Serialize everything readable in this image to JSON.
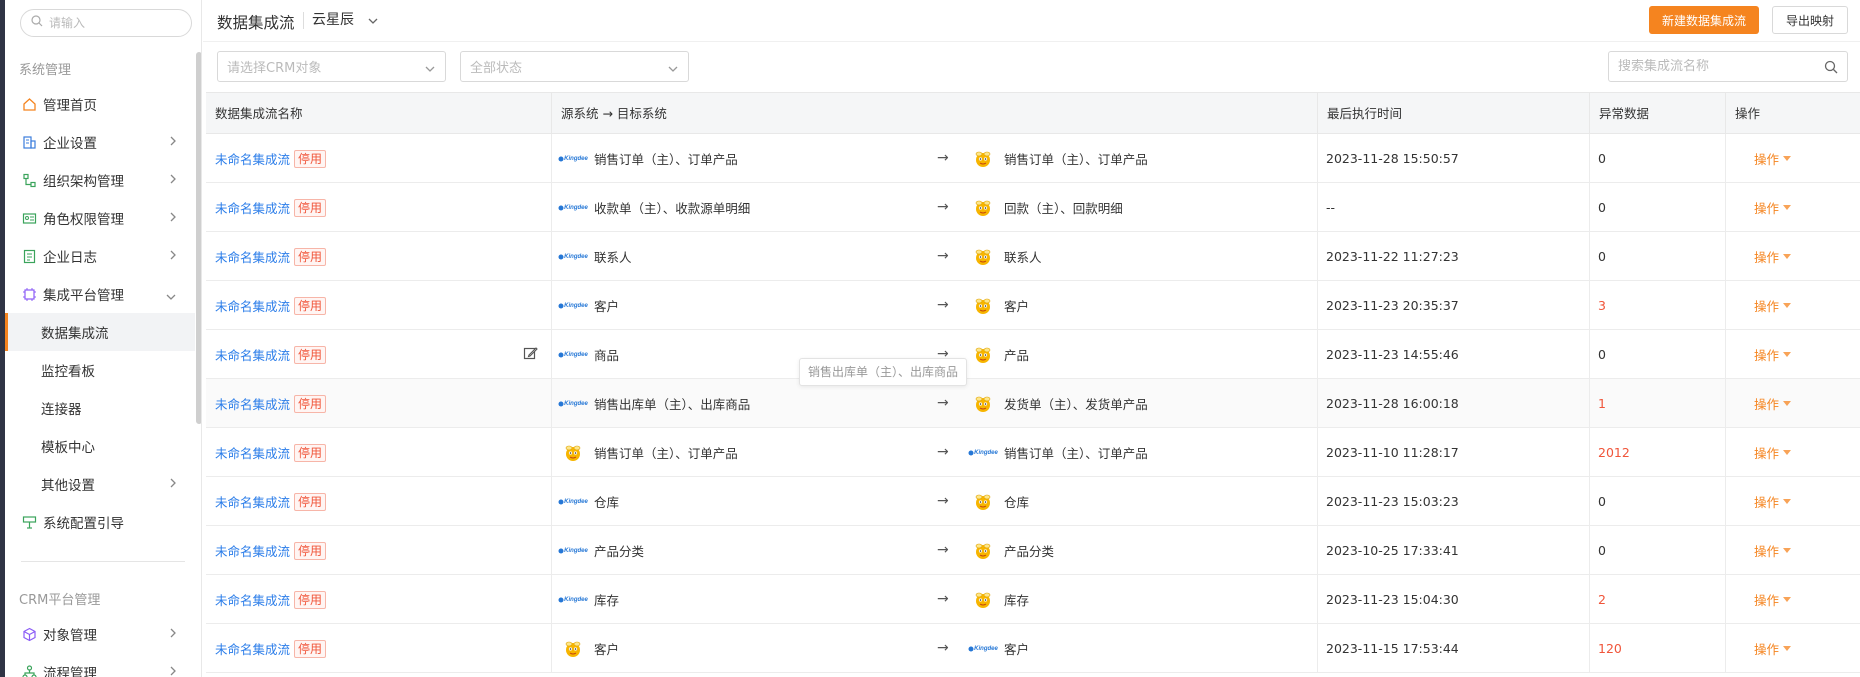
{
  "colors": {
    "accent": "#f5841f",
    "link": "#2b7de9",
    "danger": "#f0553a"
  },
  "sidebar": {
    "search_placeholder": "请输入",
    "sections": [
      {
        "title": "系统管理"
      },
      {
        "title": "CRM平台管理"
      }
    ],
    "items": [
      {
        "label": "管理首页",
        "icon": "home-icon"
      },
      {
        "label": "企业设置",
        "icon": "building-icon"
      },
      {
        "label": "组织架构管理",
        "icon": "org-tree-icon"
      },
      {
        "label": "角色权限管理",
        "icon": "id-card-icon"
      },
      {
        "label": "企业日志",
        "icon": "log-icon"
      },
      {
        "label": "集成平台管理",
        "icon": "chip-icon"
      },
      {
        "label": "数据集成流"
      },
      {
        "label": "监控看板"
      },
      {
        "label": "连接器"
      },
      {
        "label": "模板中心"
      },
      {
        "label": "其他设置"
      },
      {
        "label": "系统配置引导",
        "icon": "guide-icon"
      },
      {
        "label": "对象管理",
        "icon": "cube-icon"
      },
      {
        "label": "流程管理",
        "icon": "flow-icon"
      }
    ]
  },
  "header": {
    "title": "数据集成流",
    "tenant": "云星辰",
    "new_button": "新建数据集成流",
    "export_button": "导出映射"
  },
  "filters": {
    "crm_object_placeholder": "请选择CRM对象",
    "status_placeholder": "全部状态",
    "search_placeholder": "搜索集成流名称"
  },
  "table": {
    "columns": [
      "数据集成流名称",
      "源系统 → 目标系统",
      "最后执行时间",
      "异常数据",
      "操作"
    ],
    "status_label": "停用",
    "op_label": "操作",
    "rows": [
      {
        "name": "未命名集成流",
        "source_icon": "kingdee-logo-icon",
        "source": "销售订单（主）、订单产品",
        "target_icon": "bee-logo-icon",
        "target": "销售订单（主）、订单产品",
        "time": "2023-11-28 15:50:57",
        "errors": "0"
      },
      {
        "name": "未命名集成流",
        "source_icon": "kingdee-logo-icon",
        "source": "收款单（主）、收款源单明细",
        "target_icon": "bee-logo-icon",
        "target": "回款（主）、回款明细",
        "time": "--",
        "errors": "0"
      },
      {
        "name": "未命名集成流",
        "source_icon": "kingdee-logo-icon",
        "source": "联系人",
        "target_icon": "bee-logo-icon",
        "target": "联系人",
        "time": "2023-11-22 11:27:23",
        "errors": "0"
      },
      {
        "name": "未命名集成流",
        "source_icon": "kingdee-logo-icon",
        "source": "客户",
        "target_icon": "bee-logo-icon",
        "target": "客户",
        "time": "2023-11-23 20:35:37",
        "errors": "3"
      },
      {
        "name": "未命名集成流",
        "source_icon": "kingdee-logo-icon",
        "source": "商品",
        "target_icon": "bee-logo-icon",
        "target": "产品",
        "time": "2023-11-23 14:55:46",
        "errors": "0"
      },
      {
        "name": "未命名集成流",
        "source_icon": "kingdee-logo-icon",
        "source": "销售出库单（主）、出库商品",
        "target_icon": "bee-logo-icon",
        "target": "发货单（主）、发货单产品",
        "time": "2023-11-28 16:00:18",
        "errors": "1"
      },
      {
        "name": "未命名集成流",
        "source_icon": "bee-logo-icon",
        "source": "销售订单（主）、订单产品",
        "target_icon": "kingdee-logo-icon",
        "target": "销售订单（主）、订单产品",
        "time": "2023-11-10 11:28:17",
        "errors": "2012"
      },
      {
        "name": "未命名集成流",
        "source_icon": "kingdee-logo-icon",
        "source": "仓库",
        "target_icon": "bee-logo-icon",
        "target": "仓库",
        "time": "2023-11-23 15:03:23",
        "errors": "0"
      },
      {
        "name": "未命名集成流",
        "source_icon": "kingdee-logo-icon",
        "source": "产品分类",
        "target_icon": "bee-logo-icon",
        "target": "产品分类",
        "time": "2023-10-25 17:33:41",
        "errors": "0"
      },
      {
        "name": "未命名集成流",
        "source_icon": "kingdee-logo-icon",
        "source": "库存",
        "target_icon": "bee-logo-icon",
        "target": "库存",
        "time": "2023-11-23 15:04:30",
        "errors": "2"
      },
      {
        "name": "未命名集成流",
        "source_icon": "bee-logo-icon",
        "source": "客户",
        "target_icon": "kingdee-logo-icon",
        "target": "客户",
        "time": "2023-11-15 17:53:44",
        "errors": "120"
      }
    ]
  },
  "tooltip": {
    "text": "销售出库单（主）、出库商品"
  },
  "kingdee_logo_text": "Kingdee"
}
